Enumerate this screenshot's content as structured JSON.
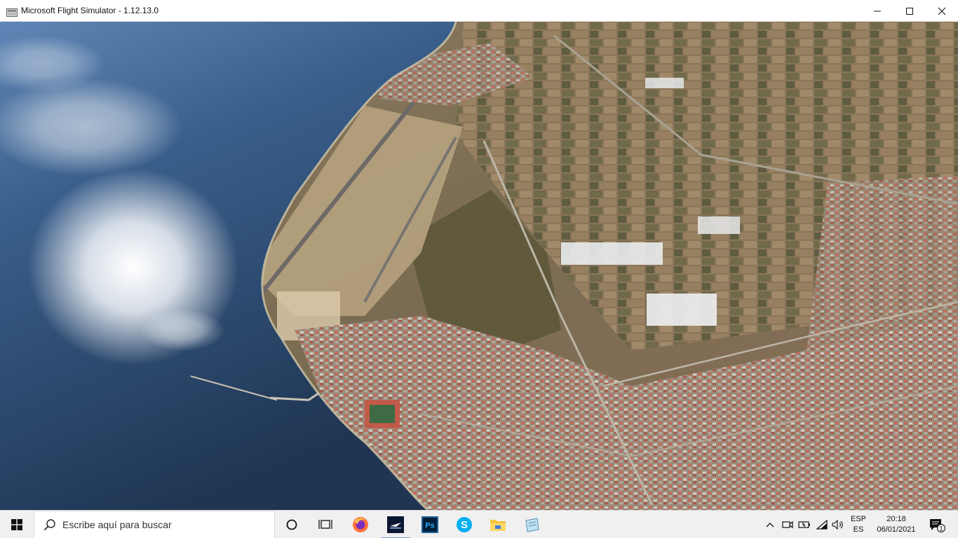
{
  "window": {
    "title": "Microsoft Flight Simulator - 1.12.13.0",
    "controls": {
      "minimize": "minimize-icon",
      "maximize": "maximize-icon",
      "close": "close-icon"
    }
  },
  "scene": {
    "description_icon": "landscape-view"
  },
  "taskbar": {
    "search_placeholder": "Escribe aquí para buscar",
    "pinned_apps": [
      {
        "name": "cortana-icon"
      },
      {
        "name": "task-view-icon"
      },
      {
        "name": "firefox-icon"
      },
      {
        "name": "flight-simulator-icon"
      },
      {
        "name": "photoshop-icon",
        "label": "Ps"
      },
      {
        "name": "skype-icon",
        "label": "S"
      },
      {
        "name": "file-explorer-icon"
      },
      {
        "name": "notepad-icon"
      }
    ],
    "tray": {
      "language_top": "ESP",
      "language_bottom": "ES",
      "time": "20:18",
      "date": "06/01/2021",
      "notification_count": "1"
    }
  },
  "colors": {
    "sea": "#2b4566",
    "land": "#8a7458",
    "taskbar_bg": "#f0f0f0",
    "accent": "#7aa7d9"
  }
}
